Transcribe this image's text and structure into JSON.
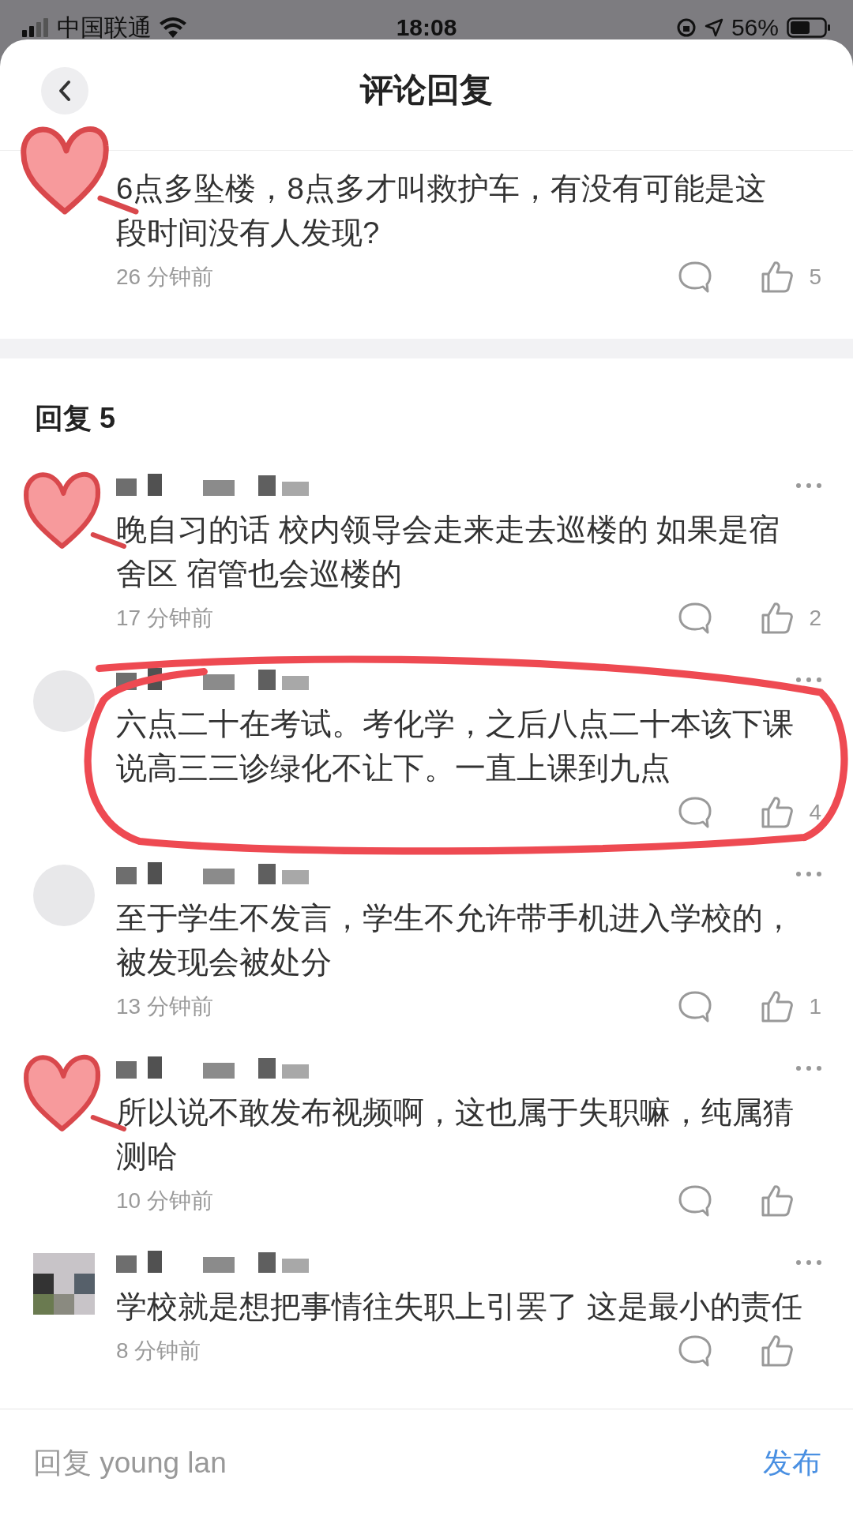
{
  "status_bar": {
    "carrier": "中国联通",
    "time": "18:08",
    "battery": "56%"
  },
  "header": {
    "title": "评论回复"
  },
  "comment": {
    "text": "6点多坠楼，8点多才叫救护车，有没有可能是这段时间没有人发现?",
    "time": "26 分钟前",
    "likes": "5",
    "heart": true
  },
  "replies_heading": "回复 5",
  "replies": [
    {
      "text": "晚自习的话 校内领导会走来走去巡楼的 如果是宿舍区 宿管也会巡楼的",
      "time": "17 分钟前",
      "likes": "2",
      "heart": true,
      "circled": false
    },
    {
      "text": "六点二十在考试。考化学，之后八点二十本该下课说高三三诊绿化不让下。一直上课到九点",
      "likes": "4",
      "heart": false,
      "circled": true
    },
    {
      "text": "至于学生不发言，学生不允许带手机进入学校的，被发现会被处分",
      "time": "13 分钟前",
      "likes": "1",
      "heart": false,
      "circled": false
    },
    {
      "text": "所以说不敢发布视频啊，这也属于失职嘛，纯属猜测哈",
      "time": "10 分钟前",
      "heart": true,
      "circled": false
    },
    {
      "pixelated": true,
      "text": "学校就是想把事情往失职上引罢了 这是最小的责任",
      "time": "8 分钟前",
      "heart": false,
      "circled": false
    }
  ],
  "footer": {
    "placeholder": "回复 young lan",
    "submit": "发布"
  }
}
